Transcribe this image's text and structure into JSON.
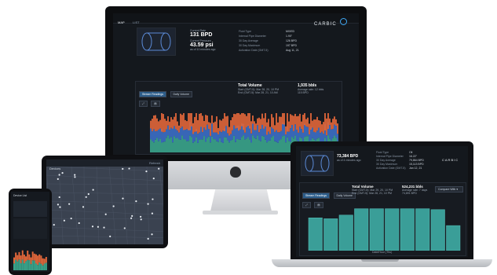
{
  "imac": {
    "tabs": [
      "MAP",
      "LIST"
    ],
    "brand": "CARBIC",
    "current_rate_label": "Current Rate",
    "current_rate": "131 BPD",
    "current_pressure_label": "Current Pressure",
    "current_pressure": "43.59 psi",
    "updated": "as of 10 minutes ago",
    "info": [
      {
        "k": "Fluid Type",
        "v": "MIXED"
      },
      {
        "k": "Internal Pipe Diameter",
        "v": "1.90\""
      },
      {
        "k": "30 Day Average",
        "v": "126 BPD"
      },
      {
        "k": "30 Day Maximum",
        "v": "197 BPD"
      },
      {
        "k": "Activation Date (GMT-5)",
        "v": "Aug 11, 21"
      }
    ],
    "buttons": [
      "Stream Readings",
      "Daily Volume"
    ],
    "total_volume_label": "Total Volume",
    "total_volume": "1,935 bbls",
    "start_line": "Start (GMT-5): Mar 28, 20, 10 PM",
    "end_line": "End (GMT-5): Mar 28, 21, 10 AM",
    "avg_line": "Average rate: 12 bbls",
    "avg_value": "115 BPD",
    "chart_color_a": "#e0663a",
    "chart_color_b": "#3c6fc7",
    "chart_color_c": "#3aa58c"
  },
  "laptop": {
    "brand": "CARBIC",
    "current_rate": "73,384 BPD",
    "updated": "as of 4 minutes ago",
    "info": [
      {
        "k": "Fluid Type",
        "v": "Oil"
      },
      {
        "k": "Internal Pipe Diameter",
        "v": "16.22\""
      },
      {
        "k": "30 Day Average",
        "v": "79,864 BPD"
      },
      {
        "k": "30 Day Maximum",
        "v": "15,113 BPD"
      },
      {
        "k": "Activation Date (GMT-5)",
        "v": "Jan 12, 21"
      }
    ],
    "buttons": [
      "Stream Readings",
      "Daily Volume"
    ],
    "total_volume_label": "Total Volume",
    "total_volume": "524,231 bbls",
    "start_line": "Start (GMT-5): Mar 29, 20, 10 PM",
    "end_line": "End (GMT-5): Mar 28, 21, 10 PM",
    "avg_line": "Average rate: 7 days",
    "avg_value": "74,891 BPD",
    "select": "Compare With",
    "xlabel": "Date/Hour (Thu)",
    "bars": [
      0.72,
      0.7,
      0.78,
      0.92,
      0.92,
      0.92,
      0.92,
      0.92,
      0.9,
      0.55
    ]
  },
  "tablet": {
    "title": "Devices",
    "action": "Refresh"
  },
  "phone": {
    "title": "Device List"
  }
}
